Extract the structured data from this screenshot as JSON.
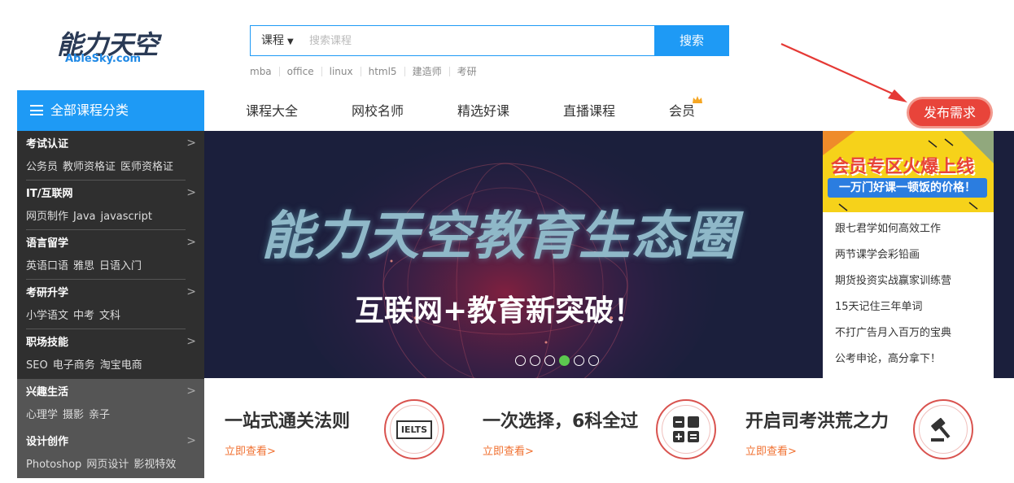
{
  "logo": {
    "cn": "能力天空",
    "en": "AbleSky.com"
  },
  "search": {
    "category": "课程",
    "placeholder": "搜索课程",
    "button": "搜索"
  },
  "hot_keywords": [
    "mba",
    "office",
    "linux",
    "html5",
    "建造师",
    "考研"
  ],
  "nav": {
    "all_categories": "全部课程分类",
    "items": [
      "课程大全",
      "网校名师",
      "精选好课",
      "直播课程",
      "会员"
    ],
    "publish": "发布需求"
  },
  "menu": [
    {
      "title": "考试认证",
      "links": [
        "公务员",
        "教师资格证",
        "医师资格证"
      ]
    },
    {
      "title": "IT/互联网",
      "links": [
        "网页制作",
        "Java",
        "javascript"
      ]
    },
    {
      "title": "语言留学",
      "links": [
        "英语口语",
        "雅思",
        "日语入门"
      ]
    },
    {
      "title": "考研升学",
      "links": [
        "小学语文",
        "中考",
        "文科"
      ]
    },
    {
      "title": "职场技能",
      "links": [
        "SEO",
        "电子商务",
        "淘宝电商"
      ]
    },
    {
      "title": "兴趣生活",
      "links": [
        "心理学",
        "摄影",
        "亲子"
      ]
    },
    {
      "title": "设计创作",
      "links": [
        "Photoshop",
        "网页设计",
        "影视特效"
      ]
    }
  ],
  "banner": {
    "title": "能力天空教育生态圈",
    "subtitle_a": "互联网+教育",
    "subtitle_b": "新突破！",
    "slides": 6,
    "active_slide": 4
  },
  "side": {
    "ad_title": "会员专区火爆上线",
    "ad_sub": "一万门好课一顿饭的价格！",
    "links": [
      "跟七君学如何高效工作",
      "两节课学会彩铅画",
      "期货投资实战赢家训练营",
      "15天记住三年单词",
      "不打广告月入百万的宝典",
      "公考申论，高分拿下！"
    ]
  },
  "features": [
    {
      "title": "一站式通关法则",
      "link": "立即查看>",
      "icon": "ielts-icon",
      "icon_text": "IELTS"
    },
    {
      "title": "一次选择，6科全过",
      "link": "立即查看>",
      "icon": "calculator-icon"
    },
    {
      "title": "开启司考洪荒之力",
      "link": "立即查看>",
      "icon": "gavel-icon"
    }
  ],
  "colors": {
    "brand": "#1e9af5",
    "accent": "#e8443a",
    "link": "#f07030",
    "active_dot": "#5cc84f"
  }
}
